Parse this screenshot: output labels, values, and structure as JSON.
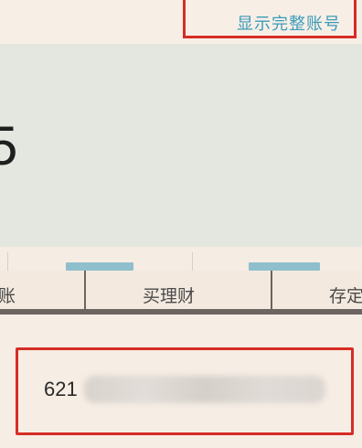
{
  "header": {
    "show_full_account_label": "显示完整账号"
  },
  "balance": {
    "visible_digit": "5"
  },
  "tabs": [
    {
      "label": "账"
    },
    {
      "label": "买理财"
    },
    {
      "label": "存定"
    }
  ],
  "account": {
    "number_prefix": "621"
  },
  "colors": {
    "highlight_border": "#d62d25",
    "link": "#3b9bb9",
    "card_bg": "#e4e7df",
    "tab_bar_dark": "#6b6460"
  }
}
